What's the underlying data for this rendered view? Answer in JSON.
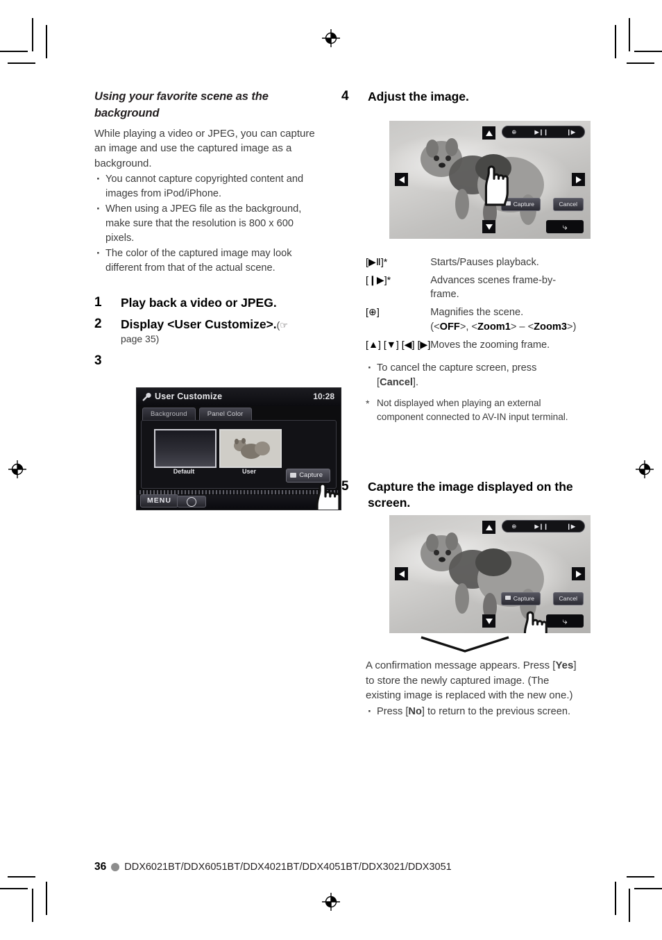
{
  "document": {
    "page_number": "36",
    "models": "DDX6021BT/DDX6051BT/DDX4021BT/DDX4051BT/DDX3021/DDX3051"
  },
  "left_column": {
    "heading": "Using your favorite scene as the background",
    "intro": "While playing a video or JPEG, you can capture an image and use the captured image as a background.",
    "bullets": [
      "You cannot capture copyrighted content and images from iPod/iPhone.",
      "When using a JPEG file as the background, make sure that the resolution is 800 x 600 pixels.",
      "The color of the captured image may look different from that of the actual scene."
    ],
    "steps": [
      {
        "num": "1",
        "title": "Play back a video or JPEG."
      },
      {
        "num": "2",
        "title": "Display <User Customize>.",
        "ref_icon": "☞",
        "ref_text": "page 35)",
        "ref_open": "("
      },
      {
        "num": "3",
        "title": ""
      }
    ]
  },
  "user_customize_screen": {
    "title": "User Customize",
    "clock": "10:28",
    "tabs": [
      {
        "label": "Background",
        "selected": true
      },
      {
        "label": "Panel Color",
        "selected": false
      }
    ],
    "thumbnails": [
      {
        "label": "Default"
      },
      {
        "label": "User"
      }
    ],
    "capture_button": "Capture",
    "menu_button": "MENU"
  },
  "right_column": {
    "steps": [
      {
        "num": "4",
        "title": "Adjust the image."
      },
      {
        "num": "5",
        "title": "Capture the image displayed on the screen."
      }
    ],
    "legend": [
      {
        "key": "[▶Ⅱ]*",
        "key_parts": [
          "▶",
          "❙❙"
        ],
        "desc": "Starts/Pauses playback."
      },
      {
        "key": "[❙▶]*",
        "desc": "Advances scenes frame-by-frame."
      },
      {
        "key": "[⊕]",
        "desc": "Magnifies the scene.",
        "desc2_pre": "(<",
        "opt1": "OFF",
        "desc2_mid": ">, <",
        "opt2": "Zoom1",
        "desc2_mid2": "> – <",
        "opt3": "Zoom3",
        "desc2_end": ">)"
      },
      {
        "key": "[▲] [▼] [◀] [▶]",
        "desc": "Moves the zooming frame."
      }
    ],
    "cancel_note_pre": "To cancel the capture screen, press [",
    "cancel_note_bold": "Cancel",
    "cancel_note_post": "].",
    "footnote_marker": "*",
    "footnote": "Not displayed when playing an external component connected to AV-IN input terminal.",
    "confirmation_pre": "A confirmation message appears. Press [",
    "confirmation_yes": "Yes",
    "confirmation_post": "] to store the newly captured image. (The existing image is replaced with the new one.)",
    "no_note_pre": "Press [",
    "no_note_bold": "No",
    "no_note_post": "] to return to the previous screen."
  },
  "capture_screen": {
    "capture_button": "Capture",
    "cancel_button": "Cancel",
    "controls": {
      "zoom": "⊕",
      "play_pause": "▶❙❙",
      "frame_advance": "❙▶"
    }
  },
  "colors": {
    "text": "#231f20",
    "body_text": "#3b3b3b",
    "footer_dot": "#8d8d8d"
  }
}
